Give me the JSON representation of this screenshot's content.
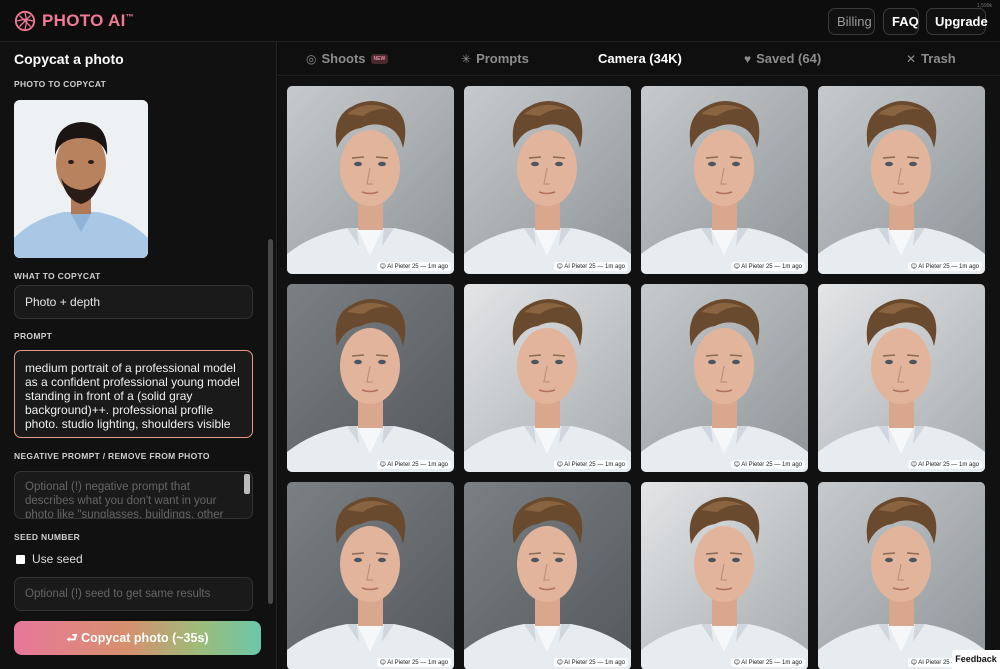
{
  "app": {
    "logo_text": "PHOTO AI",
    "logo_tm": "™",
    "corner_text": "1,599k"
  },
  "topnav": {
    "billing": "Billing",
    "faq": "FAQ",
    "upgrade": "Upgrade"
  },
  "sidebar": {
    "title": "Copycat a photo",
    "photo_label": "PHOTO TO COPYCAT",
    "what_label": "WHAT TO COPYCAT",
    "what_value": "Photo + depth",
    "prompt_label": "PROMPT",
    "prompt_value": "medium portrait of a professional model as a confident professional young model standing in front of a (solid gray background)++. professional profile photo. studio lighting, shoulders visible",
    "negative_label": "NEGATIVE PROMPT / REMOVE FROM PHOTO",
    "negative_placeholder": "Optional (!) negative prompt that describes what you don't want in your photo like \"sunglasses, buildings, other",
    "seed_label": "SEED NUMBER",
    "use_seed_label": "Use seed",
    "seed_placeholder": "Optional (!) seed to get same results",
    "copycat_button": "⮐ Copycat photo (~35s)"
  },
  "tabs": [
    {
      "label": "Shoots",
      "icon": "aperture-icon",
      "badge": "NEW",
      "active": false
    },
    {
      "label": "Prompts",
      "icon": "sparkle-icon",
      "active": false
    },
    {
      "label": "Camera (34K)",
      "active": true
    },
    {
      "label": "Saved (64)",
      "icon": "heart-icon",
      "active": false
    },
    {
      "label": "Trash",
      "icon": "x-icon",
      "active": false
    }
  ],
  "grid": {
    "tag": "😊 AI Pieter 25 — 1m ago",
    "cards": [
      {
        "bg": "mid"
      },
      {
        "bg": "mid"
      },
      {
        "bg": "mid"
      },
      {
        "bg": "mid"
      },
      {
        "bg": "dark"
      },
      {
        "bg": "light"
      },
      {
        "bg": "mid"
      },
      {
        "bg": "light"
      },
      {
        "bg": "dark"
      },
      {
        "bg": "dark"
      },
      {
        "bg": "light"
      },
      {
        "bg": "mid"
      }
    ]
  },
  "feedback": "Feedback",
  "colors": {
    "accent": "#f07a93",
    "prompt_border": "#e89b84",
    "hair": "#6a4a2e",
    "skin": "#e2b49c",
    "shirt": "#e7ecf1"
  }
}
